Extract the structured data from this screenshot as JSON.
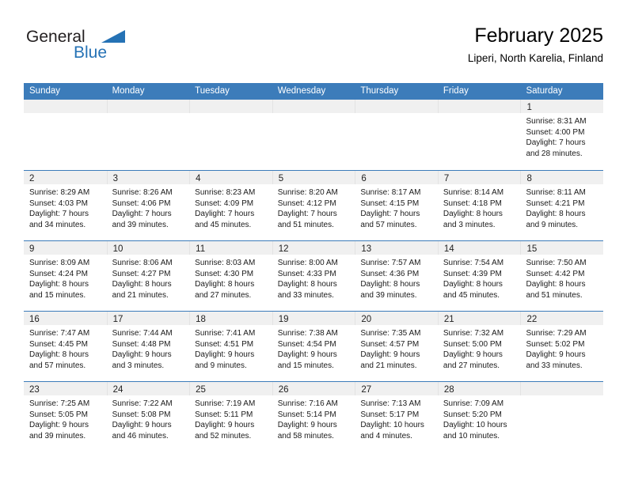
{
  "brand": {
    "name_top": "General",
    "name_bottom": "Blue",
    "triangle_color": "#2572b5"
  },
  "header": {
    "title": "February 2025",
    "subtitle": "Liperi, North Karelia, Finland"
  },
  "theme": {
    "header_bg": "#3c7cba",
    "daynum_band": "#f0f0f0",
    "text": "#1a1a1a"
  },
  "weekdays": [
    "Sunday",
    "Monday",
    "Tuesday",
    "Wednesday",
    "Thursday",
    "Friday",
    "Saturday"
  ],
  "weeks": [
    [
      {
        "day": "",
        "empty": true
      },
      {
        "day": "",
        "empty": true
      },
      {
        "day": "",
        "empty": true
      },
      {
        "day": "",
        "empty": true
      },
      {
        "day": "",
        "empty": true
      },
      {
        "day": "",
        "empty": true
      },
      {
        "day": "1",
        "sunrise": "Sunrise: 8:31 AM",
        "sunset": "Sunset: 4:00 PM",
        "daylight1": "Daylight: 7 hours",
        "daylight2": "and 28 minutes."
      }
    ],
    [
      {
        "day": "2",
        "sunrise": "Sunrise: 8:29 AM",
        "sunset": "Sunset: 4:03 PM",
        "daylight1": "Daylight: 7 hours",
        "daylight2": "and 34 minutes."
      },
      {
        "day": "3",
        "sunrise": "Sunrise: 8:26 AM",
        "sunset": "Sunset: 4:06 PM",
        "daylight1": "Daylight: 7 hours",
        "daylight2": "and 39 minutes."
      },
      {
        "day": "4",
        "sunrise": "Sunrise: 8:23 AM",
        "sunset": "Sunset: 4:09 PM",
        "daylight1": "Daylight: 7 hours",
        "daylight2": "and 45 minutes."
      },
      {
        "day": "5",
        "sunrise": "Sunrise: 8:20 AM",
        "sunset": "Sunset: 4:12 PM",
        "daylight1": "Daylight: 7 hours",
        "daylight2": "and 51 minutes."
      },
      {
        "day": "6",
        "sunrise": "Sunrise: 8:17 AM",
        "sunset": "Sunset: 4:15 PM",
        "daylight1": "Daylight: 7 hours",
        "daylight2": "and 57 minutes."
      },
      {
        "day": "7",
        "sunrise": "Sunrise: 8:14 AM",
        "sunset": "Sunset: 4:18 PM",
        "daylight1": "Daylight: 8 hours",
        "daylight2": "and 3 minutes."
      },
      {
        "day": "8",
        "sunrise": "Sunrise: 8:11 AM",
        "sunset": "Sunset: 4:21 PM",
        "daylight1": "Daylight: 8 hours",
        "daylight2": "and 9 minutes."
      }
    ],
    [
      {
        "day": "9",
        "sunrise": "Sunrise: 8:09 AM",
        "sunset": "Sunset: 4:24 PM",
        "daylight1": "Daylight: 8 hours",
        "daylight2": "and 15 minutes."
      },
      {
        "day": "10",
        "sunrise": "Sunrise: 8:06 AM",
        "sunset": "Sunset: 4:27 PM",
        "daylight1": "Daylight: 8 hours",
        "daylight2": "and 21 minutes."
      },
      {
        "day": "11",
        "sunrise": "Sunrise: 8:03 AM",
        "sunset": "Sunset: 4:30 PM",
        "daylight1": "Daylight: 8 hours",
        "daylight2": "and 27 minutes."
      },
      {
        "day": "12",
        "sunrise": "Sunrise: 8:00 AM",
        "sunset": "Sunset: 4:33 PM",
        "daylight1": "Daylight: 8 hours",
        "daylight2": "and 33 minutes."
      },
      {
        "day": "13",
        "sunrise": "Sunrise: 7:57 AM",
        "sunset": "Sunset: 4:36 PM",
        "daylight1": "Daylight: 8 hours",
        "daylight2": "and 39 minutes."
      },
      {
        "day": "14",
        "sunrise": "Sunrise: 7:54 AM",
        "sunset": "Sunset: 4:39 PM",
        "daylight1": "Daylight: 8 hours",
        "daylight2": "and 45 minutes."
      },
      {
        "day": "15",
        "sunrise": "Sunrise: 7:50 AM",
        "sunset": "Sunset: 4:42 PM",
        "daylight1": "Daylight: 8 hours",
        "daylight2": "and 51 minutes."
      }
    ],
    [
      {
        "day": "16",
        "sunrise": "Sunrise: 7:47 AM",
        "sunset": "Sunset: 4:45 PM",
        "daylight1": "Daylight: 8 hours",
        "daylight2": "and 57 minutes."
      },
      {
        "day": "17",
        "sunrise": "Sunrise: 7:44 AM",
        "sunset": "Sunset: 4:48 PM",
        "daylight1": "Daylight: 9 hours",
        "daylight2": "and 3 minutes."
      },
      {
        "day": "18",
        "sunrise": "Sunrise: 7:41 AM",
        "sunset": "Sunset: 4:51 PM",
        "daylight1": "Daylight: 9 hours",
        "daylight2": "and 9 minutes."
      },
      {
        "day": "19",
        "sunrise": "Sunrise: 7:38 AM",
        "sunset": "Sunset: 4:54 PM",
        "daylight1": "Daylight: 9 hours",
        "daylight2": "and 15 minutes."
      },
      {
        "day": "20",
        "sunrise": "Sunrise: 7:35 AM",
        "sunset": "Sunset: 4:57 PM",
        "daylight1": "Daylight: 9 hours",
        "daylight2": "and 21 minutes."
      },
      {
        "day": "21",
        "sunrise": "Sunrise: 7:32 AM",
        "sunset": "Sunset: 5:00 PM",
        "daylight1": "Daylight: 9 hours",
        "daylight2": "and 27 minutes."
      },
      {
        "day": "22",
        "sunrise": "Sunrise: 7:29 AM",
        "sunset": "Sunset: 5:02 PM",
        "daylight1": "Daylight: 9 hours",
        "daylight2": "and 33 minutes."
      }
    ],
    [
      {
        "day": "23",
        "sunrise": "Sunrise: 7:25 AM",
        "sunset": "Sunset: 5:05 PM",
        "daylight1": "Daylight: 9 hours",
        "daylight2": "and 39 minutes."
      },
      {
        "day": "24",
        "sunrise": "Sunrise: 7:22 AM",
        "sunset": "Sunset: 5:08 PM",
        "daylight1": "Daylight: 9 hours",
        "daylight2": "and 46 minutes."
      },
      {
        "day": "25",
        "sunrise": "Sunrise: 7:19 AM",
        "sunset": "Sunset: 5:11 PM",
        "daylight1": "Daylight: 9 hours",
        "daylight2": "and 52 minutes."
      },
      {
        "day": "26",
        "sunrise": "Sunrise: 7:16 AM",
        "sunset": "Sunset: 5:14 PM",
        "daylight1": "Daylight: 9 hours",
        "daylight2": "and 58 minutes."
      },
      {
        "day": "27",
        "sunrise": "Sunrise: 7:13 AM",
        "sunset": "Sunset: 5:17 PM",
        "daylight1": "Daylight: 10 hours",
        "daylight2": "and 4 minutes."
      },
      {
        "day": "28",
        "sunrise": "Sunrise: 7:09 AM",
        "sunset": "Sunset: 5:20 PM",
        "daylight1": "Daylight: 10 hours",
        "daylight2": "and 10 minutes."
      },
      {
        "day": "",
        "empty": true
      }
    ]
  ]
}
